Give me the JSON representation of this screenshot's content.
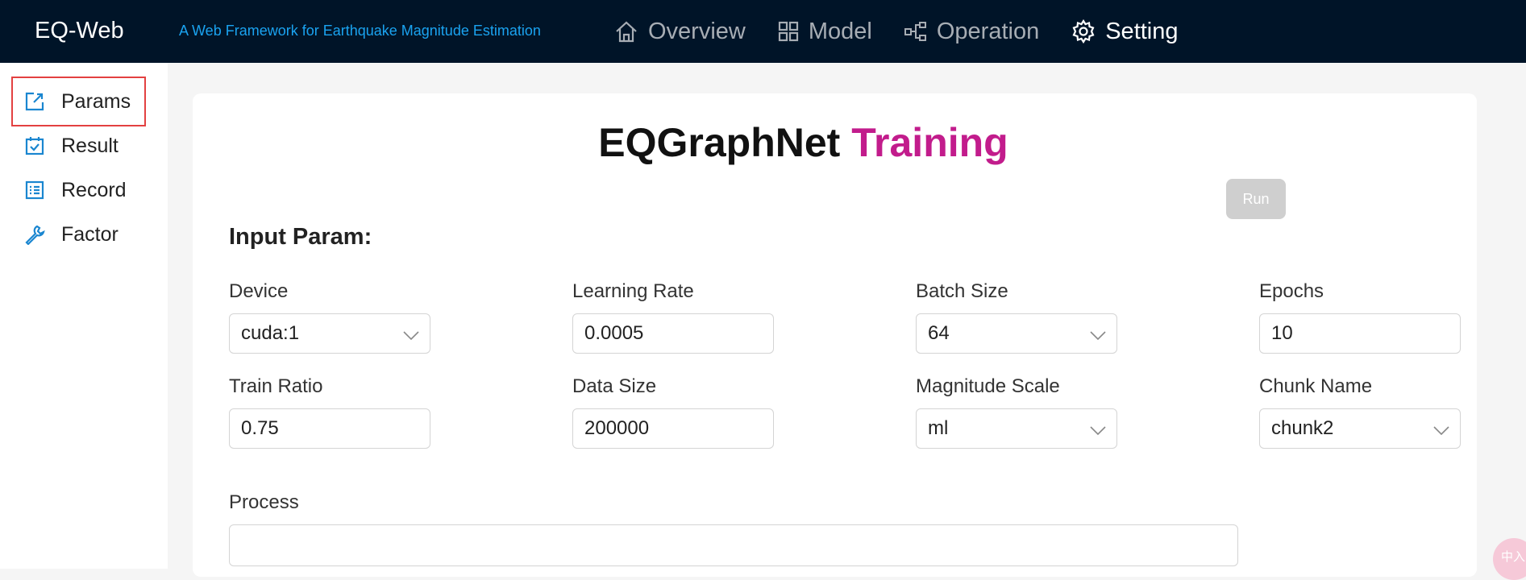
{
  "header": {
    "brand": "EQ-Web",
    "subtitle": "A Web Framework for Earthquake Magnitude Estimation",
    "nav": [
      {
        "label": "Overview",
        "icon": "home-icon"
      },
      {
        "label": "Model",
        "icon": "grid-icon"
      },
      {
        "label": "Operation",
        "icon": "flow-icon"
      },
      {
        "label": "Setting",
        "icon": "gear-icon",
        "active": true
      }
    ]
  },
  "sidebar": {
    "items": [
      {
        "label": "Params",
        "icon": "edit-icon",
        "selected": true
      },
      {
        "label": "Result",
        "icon": "calendar-check-icon"
      },
      {
        "label": "Record",
        "icon": "list-icon"
      },
      {
        "label": "Factor",
        "icon": "wrench-icon"
      }
    ]
  },
  "main": {
    "title_main": "EQGraphNet",
    "title_accent": "Training",
    "run_label": "Run",
    "section_title": "Input Param:",
    "fields": [
      {
        "label": "Device",
        "value": "cuda:1",
        "type": "select"
      },
      {
        "label": "Learning Rate",
        "value": "0.0005",
        "type": "input"
      },
      {
        "label": "Batch Size",
        "value": "64",
        "type": "select"
      },
      {
        "label": "Epochs",
        "value": "10",
        "type": "input"
      },
      {
        "label": "Train Ratio",
        "value": "0.75",
        "type": "input"
      },
      {
        "label": "Data Size",
        "value": "200000",
        "type": "input"
      },
      {
        "label": "Magnitude Scale",
        "value": "ml",
        "type": "select"
      },
      {
        "label": "Chunk Name",
        "value": "chunk2",
        "type": "select"
      }
    ],
    "process_label": "Process",
    "process_value": ""
  },
  "floating_badge": "中入",
  "colors": {
    "header_bg": "#001428",
    "subtitle": "#1aa3f0",
    "accent": "#c21c8c",
    "sidebar_icon": "#1a86d0",
    "selected_border": "#e34141"
  }
}
